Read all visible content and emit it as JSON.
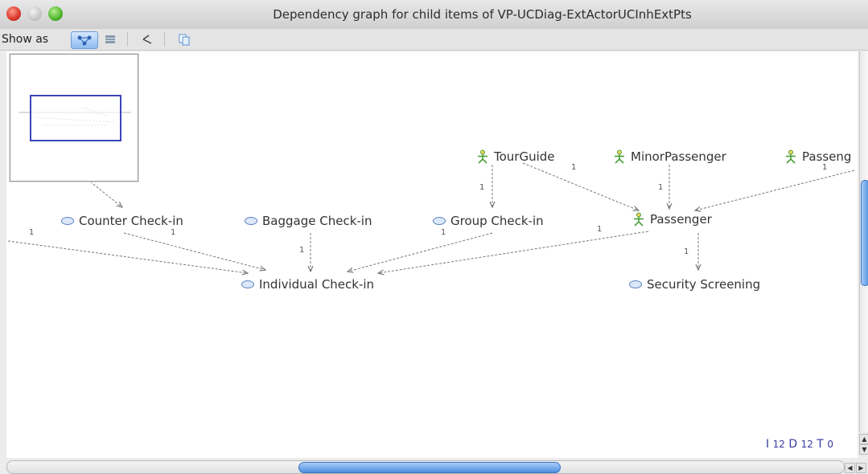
{
  "window": {
    "title": "Dependency graph for child items of VP-UCDiag-ExtActorUCInhExtPts"
  },
  "toolbar": {
    "show_as_label": "Show as"
  },
  "nodes": {
    "tourguide": "TourGuide",
    "minorpassenger": "MinorPassenger",
    "passenger_partial": "Passeng",
    "counter_checkin": "Counter Check-in",
    "baggage_checkin": "Baggage Check-in",
    "group_checkin": "Group Check-in",
    "passenger": "Passenger",
    "individual_checkin": "Individual Check-in",
    "security_screening": "Security Screening"
  },
  "edge_label": "1",
  "stats": {
    "i_label": "I",
    "i_value": "12",
    "d_label": "D",
    "d_value": "12",
    "t_label": "T",
    "t_value": "0"
  },
  "colors": {
    "actor": "#4aa03a",
    "usecase": "#5a7fbf",
    "scroll_thumb": "#4f8fe0",
    "stats": "#3a3aa0"
  }
}
